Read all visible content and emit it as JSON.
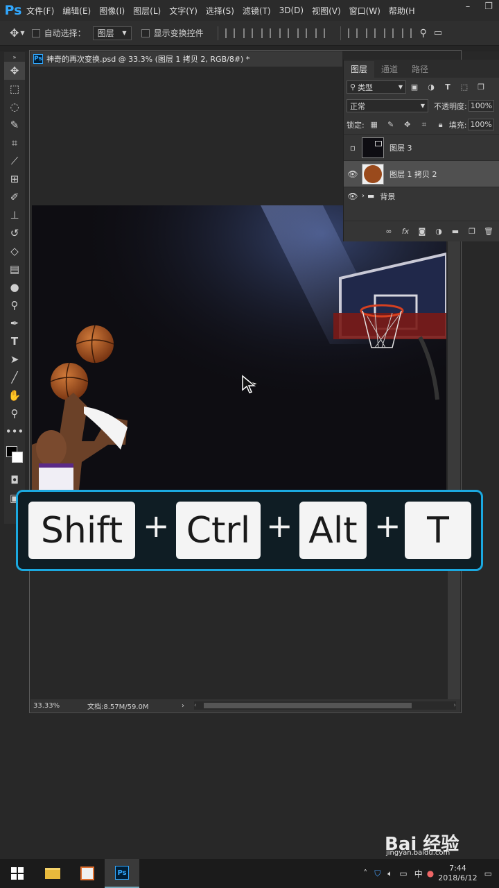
{
  "menubar": {
    "logo": "Ps",
    "items": [
      "文件(F)",
      "编辑(E)",
      "图像(I)",
      "图层(L)",
      "文字(Y)",
      "选择(S)",
      "滤镜(T)",
      "3D(D)",
      "视图(V)",
      "窗口(W)",
      "帮助(H"
    ]
  },
  "options": {
    "auto_select_label": "自动选择：",
    "auto_select_value": "图层",
    "show_transform_label": "显示变换控件"
  },
  "document": {
    "tab_title": "神奇的再次变换.psd @ 33.3% (图层 1 拷贝 2, RGB/8#) *",
    "zoom": "33.33%",
    "doc_info": "文档:8.57M/59.0M"
  },
  "layers_panel": {
    "tabs": [
      "图层",
      "通道",
      "路径"
    ],
    "filter_label": "类型",
    "blend_mode": "正常",
    "opacity_label": "不透明度:",
    "opacity_value": "100%",
    "lock_label": "锁定:",
    "fill_label": "填充:",
    "fill_value": "100%",
    "layers": [
      {
        "name": "图层 3",
        "visible": false,
        "selected": false
      },
      {
        "name": "图层 1 拷贝 2",
        "visible": true,
        "selected": true
      },
      {
        "name": "背景",
        "visible": true,
        "selected": false,
        "type": "group"
      }
    ]
  },
  "shortcut": {
    "keys": [
      "Shift",
      "Ctrl",
      "Alt",
      "T"
    ],
    "separator": "+"
  },
  "taskbar": {
    "ime": "中",
    "date": "2018/6/12",
    "time": "7:44"
  },
  "watermark": "Bai 经验",
  "watermark_url": "jingyan.baidu.com"
}
